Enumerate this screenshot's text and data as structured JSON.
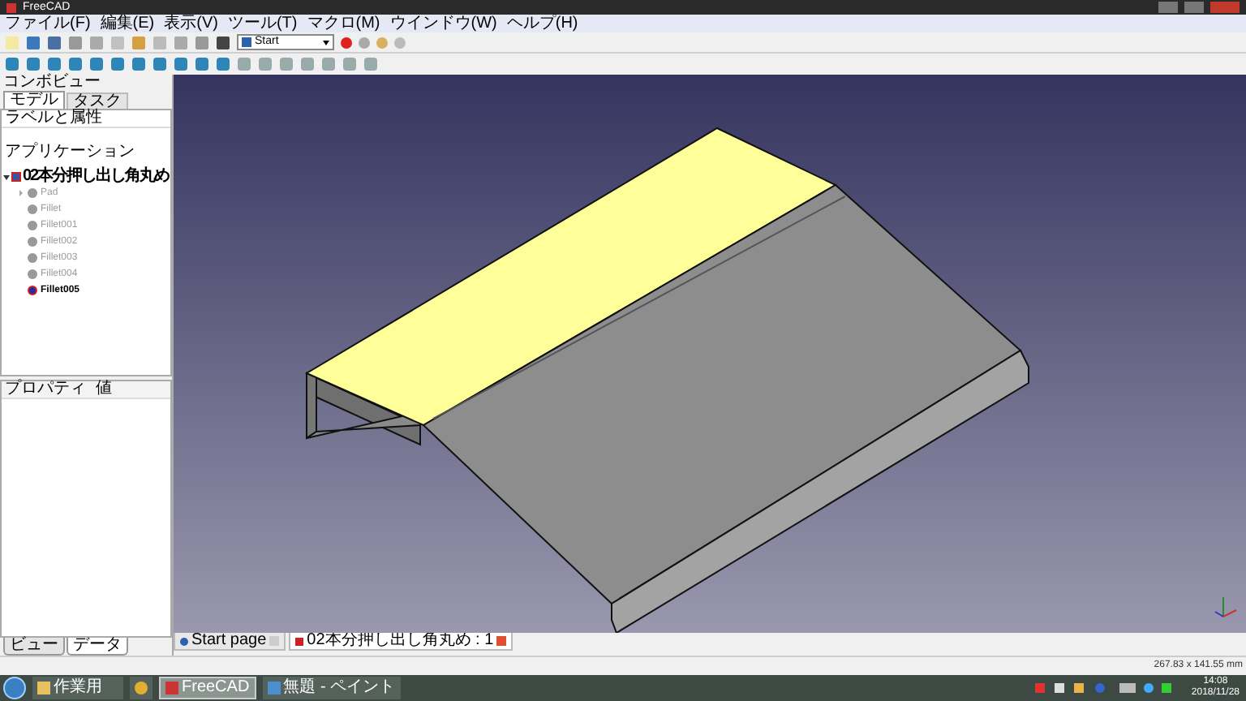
{
  "window": {
    "title": "FreeCAD"
  },
  "menu": [
    "ファイル(F)",
    "編集(E)",
    "表示(V)",
    "ツール(T)",
    "マクロ(M)",
    "ウインドウ(W)",
    "ヘルプ(H)"
  ],
  "workbench": {
    "value": "Start"
  },
  "combo_view": {
    "title": "コンボビュー",
    "tabs": [
      {
        "label": "モデル",
        "selected": true
      },
      {
        "label": "タスク",
        "selected": false
      }
    ],
    "section_label": "ラベルと属性",
    "group_label": "アプリケーション",
    "tree": [
      {
        "label": "02本分押し出し角丸め",
        "expanded": true,
        "visible": true,
        "children": [
          {
            "label": "Pad",
            "visible": false,
            "expandable": true
          },
          {
            "label": "Fillet",
            "visible": false,
            "expandable": false
          },
          {
            "label": "Fillet001",
            "visible": false,
            "expandable": false
          },
          {
            "label": "Fillet002",
            "visible": false,
            "expandable": false
          },
          {
            "label": "Fillet003",
            "visible": false,
            "expandable": false
          },
          {
            "label": "Fillet004",
            "visible": false,
            "expandable": false
          },
          {
            "label": "Fillet005",
            "visible": true,
            "expandable": false
          }
        ]
      }
    ],
    "property_columns": [
      "プロパティ",
      "値"
    ],
    "bottom_tabs": [
      {
        "label": "ビュー",
        "selected": false
      },
      {
        "label": "データ",
        "selected": true
      }
    ]
  },
  "document_tabs": [
    {
      "label": "Start page",
      "selected": false
    },
    {
      "label": "02本分押し出し角丸め : 1",
      "selected": true
    }
  ],
  "status_bar": {
    "dimensions": "267.83 x 141.55 mm"
  },
  "taskbar": {
    "items": [
      {
        "label": "作業用",
        "kind": "folder",
        "active": false
      },
      {
        "kind": "chrome",
        "active": false
      },
      {
        "label": "FreeCAD",
        "kind": "freecad",
        "active": true
      },
      {
        "label": "無題 - ペイント",
        "kind": "paint",
        "active": false
      }
    ],
    "time": "14:08",
    "date": "2018/11/28"
  }
}
